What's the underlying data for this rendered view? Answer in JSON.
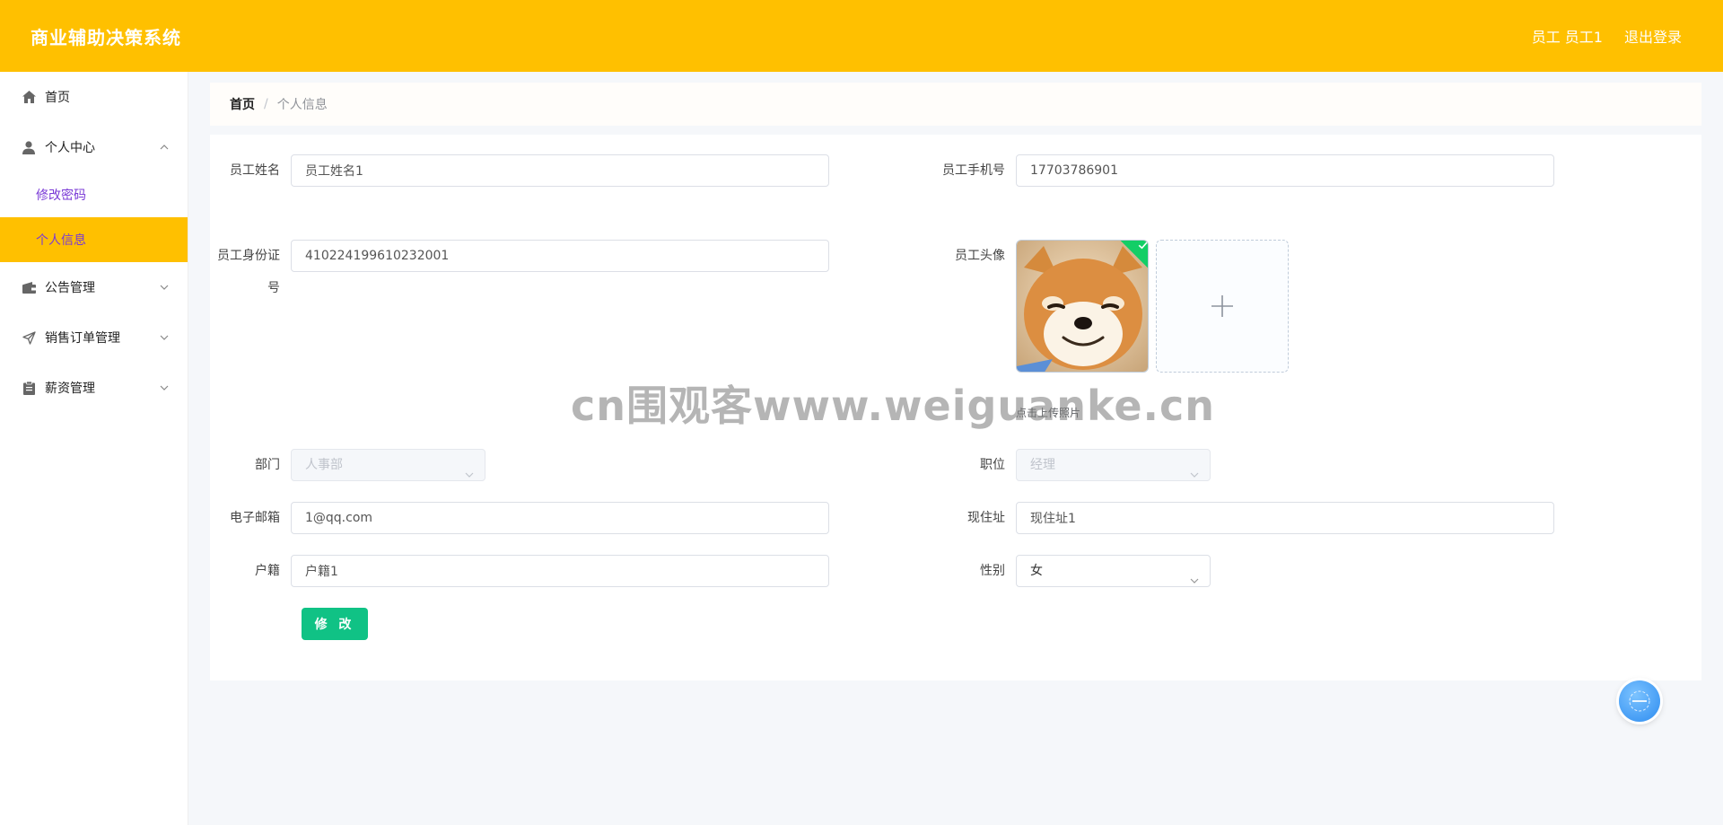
{
  "header": {
    "title": "商业辅助决策系统",
    "user": "员工 员工1",
    "logout": "退出登录"
  },
  "colors": {
    "header_bg": "#ffc000",
    "accent": "#ffc000",
    "submit": "#10c285",
    "submenu_text": "#7a3ad6"
  },
  "sidebar": {
    "items": [
      {
        "label": "首页",
        "icon": "home-icon"
      },
      {
        "label": "个人中心",
        "icon": "user-icon",
        "expanded": true,
        "children": [
          {
            "label": "修改密码"
          },
          {
            "label": "个人信息",
            "active": true
          }
        ]
      },
      {
        "label": "公告管理",
        "icon": "wallet-icon"
      },
      {
        "label": "销售订单管理",
        "icon": "send-icon"
      },
      {
        "label": "薪资管理",
        "icon": "clipboard-icon"
      }
    ]
  },
  "breadcrumb": {
    "home": "首页",
    "separator": "/",
    "current": "个人信息"
  },
  "form": {
    "name": {
      "label": "员工姓名",
      "value": "员工姓名1"
    },
    "phone": {
      "label": "员工手机号",
      "value": "17703786901"
    },
    "id_card": {
      "label": "员工身份证号",
      "value": "410224199610232001"
    },
    "avatar": {
      "label": "员工头像",
      "tip": "点击上传照片"
    },
    "department": {
      "label": "部门",
      "value": "人事部"
    },
    "position": {
      "label": "职位",
      "value": "经理"
    },
    "email": {
      "label": "电子邮箱",
      "value": "1@qq.com"
    },
    "address": {
      "label": "现住址",
      "value": "现住址1"
    },
    "hometown": {
      "label": "户籍",
      "value": "户籍1"
    },
    "gender": {
      "label": "性别",
      "value": "女"
    },
    "submit": "修 改"
  },
  "watermark": "cn围观客www.weiguanke.cn"
}
